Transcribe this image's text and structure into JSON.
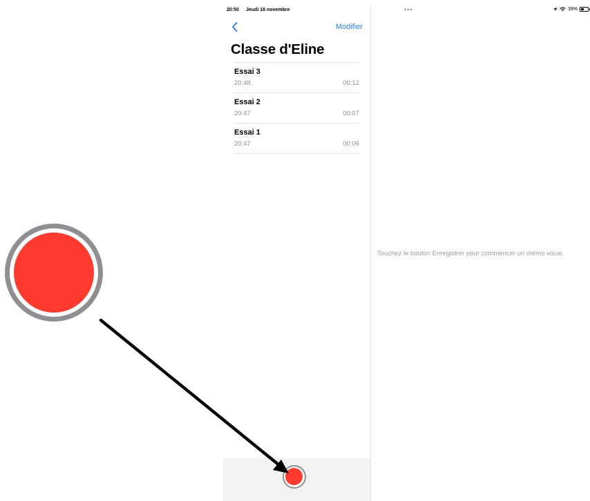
{
  "status_bar": {
    "time": "20:50",
    "date": "Jeudi 18 novembre",
    "dots": "•••",
    "battery_percent": "39%"
  },
  "nav": {
    "edit_label": "Modifier"
  },
  "folder": {
    "title": "Classe d'Eline"
  },
  "recordings": [
    {
      "name": "Essai 3",
      "time": "20:48",
      "duration": "00:12"
    },
    {
      "name": "Essai 2",
      "time": "20:47",
      "duration": "00:07"
    },
    {
      "name": "Essai 1",
      "time": "20:47",
      "duration": "00:06"
    }
  ],
  "detail": {
    "hint": "Touchez le bouton Enregistrer pour commencer un mémo vocal."
  },
  "colors": {
    "accent": "#2f80e8",
    "record": "#ff3b30",
    "secondary_text": "#8e8e93"
  }
}
